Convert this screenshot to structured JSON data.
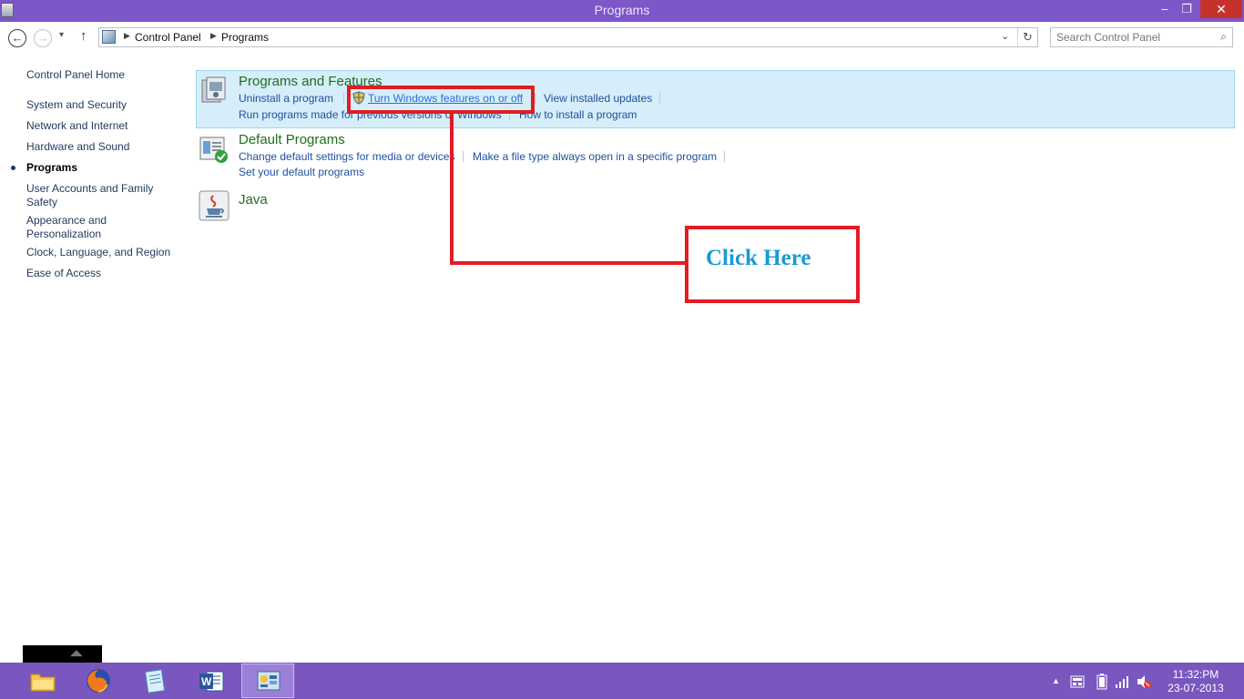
{
  "window": {
    "title": "Programs"
  },
  "window_controls": {
    "minimize": "‒",
    "maximize": "❐",
    "close": "✕"
  },
  "nav": {
    "back": "←",
    "forward": "→",
    "history": "▾",
    "up": "↑",
    "breadcrumbs": [
      "Control Panel",
      "Programs"
    ],
    "refresh": "↻",
    "dropdown": "⌄"
  },
  "search": {
    "placeholder": "Search Control Panel",
    "icon": "⌕"
  },
  "sidebar": {
    "items": [
      {
        "label": "Control Panel Home"
      },
      {
        "label": "System and Security"
      },
      {
        "label": "Network and Internet"
      },
      {
        "label": "Hardware and Sound"
      },
      {
        "label": "Programs",
        "current": true
      },
      {
        "label": "User Accounts and Family Safety"
      },
      {
        "label": "Appearance and Personalization"
      },
      {
        "label": "Clock, Language, and Region"
      },
      {
        "label": "Ease of Access"
      }
    ]
  },
  "categories": [
    {
      "title": "Programs and Features",
      "tasks": [
        "Uninstall a program",
        "Turn Windows features on or off",
        "View installed updates",
        "Run programs made for previous versions of Windows",
        "How to install a program"
      ]
    },
    {
      "title": "Default Programs",
      "tasks": [
        "Change default settings for media or devices",
        "Make a file type always open in a specific program",
        "Set your default programs"
      ]
    },
    {
      "title": "Java",
      "tasks": []
    }
  ],
  "annotation": {
    "label": "Click Here",
    "color": "#e31b23",
    "text_color": "#1a9ad6"
  },
  "taskbar": {
    "apps": [
      {
        "name": "File Explorer",
        "icon": "folder-icon"
      },
      {
        "name": "Firefox",
        "icon": "firefox-icon"
      },
      {
        "name": "Notepad",
        "icon": "notepad-icon"
      },
      {
        "name": "Word",
        "icon": "word-icon",
        "letter": "W"
      },
      {
        "name": "Control Panel",
        "icon": "control-panel-icon",
        "active": true
      }
    ],
    "tray": {
      "show_hidden": "▲",
      "time": "11:32:PM",
      "date": "23-07-2013"
    }
  },
  "colors": {
    "titlebar": "#7b57c8",
    "taskbar": "#7957bf",
    "link": "#1e4f9e",
    "category_title": "#1e6f1e"
  }
}
